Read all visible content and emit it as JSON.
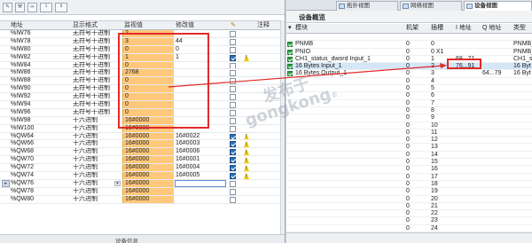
{
  "toolbar": {
    "icons": [
      "pencil-icon",
      "wrench-icon",
      "eyeglasses-icon",
      "monitor-once-icon",
      "monitor-all-icon"
    ],
    "labels": [
      "✎",
      "⚒",
      "∞",
      "1",
      "Ⅱ"
    ]
  },
  "watch_table": {
    "headers": {
      "address": "地址",
      "display_format": "显示格式",
      "monitor_value": "监视值",
      "modify_value": "修改值",
      "modify_flag": "",
      "comment": "注释"
    },
    "rows": [
      {
        "address": "%IW76",
        "format": "无符号十进制",
        "monitor": "2",
        "modify": "",
        "checked": false,
        "warn": false
      },
      {
        "address": "%IW78",
        "format": "无符号十进制",
        "monitor": "3",
        "modify": "44",
        "checked": false,
        "warn": false
      },
      {
        "address": "%IW80",
        "format": "无符号十进制",
        "monitor": "0",
        "modify": "0",
        "checked": false,
        "warn": false
      },
      {
        "address": "%IW82",
        "format": "无符号十进制",
        "monitor": "1",
        "modify": "1",
        "checked": true,
        "warn": true
      },
      {
        "address": "%IW84",
        "format": "无符号十进制",
        "monitor": "0",
        "modify": "",
        "checked": false,
        "warn": false
      },
      {
        "address": "%IW86",
        "format": "无符号十进制",
        "monitor": "2768",
        "modify": "",
        "checked": false,
        "warn": false
      },
      {
        "address": "%IW88",
        "format": "无符号十进制",
        "monitor": "0",
        "modify": "",
        "checked": false,
        "warn": false
      },
      {
        "address": "%IW90",
        "format": "无符号十进制",
        "monitor": "0",
        "modify": "",
        "checked": false,
        "warn": false
      },
      {
        "address": "%IW92",
        "format": "无符号十进制",
        "monitor": "0",
        "modify": "",
        "checked": false,
        "warn": false
      },
      {
        "address": "%IW94",
        "format": "无符号十进制",
        "monitor": "0",
        "modify": "",
        "checked": false,
        "warn": false
      },
      {
        "address": "%IW96",
        "format": "无符号十进制",
        "monitor": "0",
        "modify": "",
        "checked": false,
        "warn": false
      },
      {
        "address": "%IW98",
        "format": "十六进制",
        "monitor": "16#0000",
        "modify": "",
        "checked": false,
        "warn": false
      },
      {
        "address": "%IW100",
        "format": "十六进制",
        "monitor": "16#0000",
        "modify": "",
        "checked": false,
        "warn": false
      },
      {
        "address": "%QW64",
        "format": "十六进制",
        "monitor": "16#0000",
        "modify": "16#0022",
        "checked": true,
        "warn": true
      },
      {
        "address": "%QW66",
        "format": "十六进制",
        "monitor": "16#0000",
        "modify": "16#0003",
        "checked": true,
        "warn": true
      },
      {
        "address": "%QW68",
        "format": "十六进制",
        "monitor": "16#0000",
        "modify": "16#0006",
        "checked": true,
        "warn": true
      },
      {
        "address": "%QW70",
        "format": "十六进制",
        "monitor": "16#0000",
        "modify": "16#0001",
        "checked": true,
        "warn": true
      },
      {
        "address": "%QW72",
        "format": "十六进制",
        "monitor": "16#0000",
        "modify": "16#0004",
        "checked": true,
        "warn": true
      },
      {
        "address": "%QW74",
        "format": "十六进制",
        "monitor": "16#0000",
        "modify": "16#0005",
        "checked": true,
        "warn": true
      },
      {
        "address": "%QW76",
        "format": "十六进制",
        "monitor": "16#0000",
        "modify": "",
        "checked": false,
        "warn": false
      },
      {
        "address": "%QW78",
        "format": "十六进制",
        "monitor": "16#0000",
        "modify": "",
        "checked": false,
        "warn": false
      },
      {
        "address": "%QW80",
        "format": "十六进制",
        "monitor": "16#0000",
        "modify": "",
        "checked": false,
        "warn": false
      }
    ],
    "bottom_label": "设备信息"
  },
  "right_pane": {
    "tabs": [
      {
        "label": "拓扑视图",
        "active": false
      },
      {
        "label": "网络视图",
        "active": false
      },
      {
        "label": "设备视图",
        "active": true
      }
    ],
    "title": "设备概览",
    "headers": {
      "module": "模块",
      "rack": "机架",
      "slot": "插槽",
      "i_address": "I 地址",
      "q_address": "Q 地址",
      "type": "类型"
    },
    "rows": [
      {
        "module": "",
        "rack": "",
        "slot": "",
        "i": "",
        "q": "",
        "type": "",
        "ok": false
      },
      {
        "module": "PNMB",
        "rack": "0",
        "slot": "0",
        "i": "",
        "q": "",
        "type": "PNMB_e",
        "ok": true
      },
      {
        "module": "  PNIO",
        "rack": "0",
        "slot": "0 X1",
        "i": "",
        "q": "",
        "type": "PNMB_e",
        "ok": true
      },
      {
        "module": "CH1_status_dword Input_1",
        "rack": "0",
        "slot": "1",
        "i": "68...71",
        "q": "",
        "type": "CH1_st",
        "ok": true
      },
      {
        "module": "16 Bytes Input_1",
        "rack": "0",
        "slot": "2",
        "i": "76...91",
        "q": "",
        "type": "16 Byt",
        "ok": true
      },
      {
        "module": "16 Bytes Output_1",
        "rack": "0",
        "slot": "3",
        "i": "",
        "q": "64...79",
        "type": "16 Byt",
        "ok": true
      },
      {
        "module": "",
        "rack": "0",
        "slot": "4",
        "i": "",
        "q": "",
        "type": "",
        "ok": false
      },
      {
        "module": "",
        "rack": "0",
        "slot": "5",
        "i": "",
        "q": "",
        "type": "",
        "ok": false
      },
      {
        "module": "",
        "rack": "0",
        "slot": "6",
        "i": "",
        "q": "",
        "type": "",
        "ok": false
      },
      {
        "module": "",
        "rack": "0",
        "slot": "7",
        "i": "",
        "q": "",
        "type": "",
        "ok": false
      },
      {
        "module": "",
        "rack": "0",
        "slot": "8",
        "i": "",
        "q": "",
        "type": "",
        "ok": false
      },
      {
        "module": "",
        "rack": "0",
        "slot": "9",
        "i": "",
        "q": "",
        "type": "",
        "ok": false
      },
      {
        "module": "",
        "rack": "0",
        "slot": "10",
        "i": "",
        "q": "",
        "type": "",
        "ok": false
      },
      {
        "module": "",
        "rack": "0",
        "slot": "11",
        "i": "",
        "q": "",
        "type": "",
        "ok": false
      },
      {
        "module": "",
        "rack": "0",
        "slot": "12",
        "i": "",
        "q": "",
        "type": "",
        "ok": false
      },
      {
        "module": "",
        "rack": "0",
        "slot": "13",
        "i": "",
        "q": "",
        "type": "",
        "ok": false
      },
      {
        "module": "",
        "rack": "0",
        "slot": "14",
        "i": "",
        "q": "",
        "type": "",
        "ok": false
      },
      {
        "module": "",
        "rack": "0",
        "slot": "15",
        "i": "",
        "q": "",
        "type": "",
        "ok": false
      },
      {
        "module": "",
        "rack": "0",
        "slot": "16",
        "i": "",
        "q": "",
        "type": "",
        "ok": false
      },
      {
        "module": "",
        "rack": "0",
        "slot": "17",
        "i": "",
        "q": "",
        "type": "",
        "ok": false
      },
      {
        "module": "",
        "rack": "0",
        "slot": "18",
        "i": "",
        "q": "",
        "type": "",
        "ok": false
      },
      {
        "module": "",
        "rack": "0",
        "slot": "19",
        "i": "",
        "q": "",
        "type": "",
        "ok": false
      },
      {
        "module": "",
        "rack": "0",
        "slot": "20",
        "i": "",
        "q": "",
        "type": "",
        "ok": false
      },
      {
        "module": "",
        "rack": "0",
        "slot": "21",
        "i": "",
        "q": "",
        "type": "",
        "ok": false
      },
      {
        "module": "",
        "rack": "0",
        "slot": "22",
        "i": "",
        "q": "",
        "type": "",
        "ok": false
      },
      {
        "module": "",
        "rack": "0",
        "slot": "23",
        "i": "",
        "q": "",
        "type": "",
        "ok": false
      },
      {
        "module": "",
        "rack": "0",
        "slot": "24",
        "i": "",
        "q": "",
        "type": "",
        "ok": false
      }
    ]
  },
  "watermark": {
    "line1": "发布于",
    "line2": "gongkong",
    "registered": "®"
  },
  "colors": {
    "monitor_cell": "#ffc87a",
    "highlight": "#e12a2a",
    "ok_green": "#2f9e44"
  }
}
